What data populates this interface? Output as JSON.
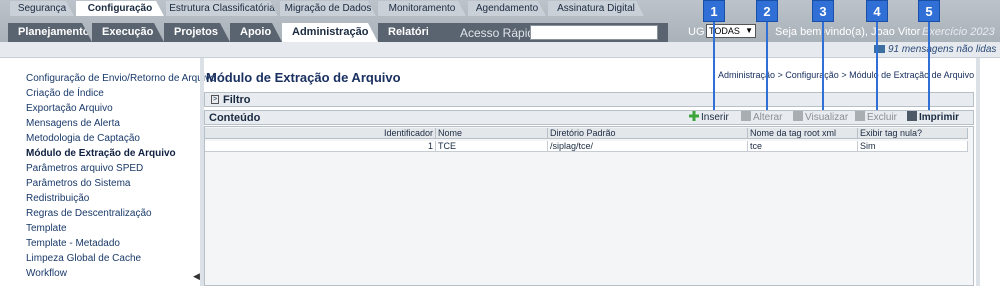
{
  "main_menu": [
    "Planejamento",
    "Execução",
    "Projetos",
    "Apoio",
    "Administração",
    "Relatórios"
  ],
  "active_main": "Administração",
  "quick_access": {
    "label": "Acesso Rápido",
    "value": ""
  },
  "ug": {
    "label": "UG",
    "value": "TODAS"
  },
  "welcome": "Seja bem-vindo(a), Joao Vitor",
  "exercise": "Exercício 2023",
  "sub_tabs": [
    "Segurança",
    "Configuração",
    "Estrutura Classificatória",
    "Migração de Dados",
    "Monitoramento",
    "Agendamento",
    "Assinatura Digital"
  ],
  "active_sub": "Configuração",
  "messages": "91 mensagens não lidas",
  "sidebar": {
    "items": [
      "Configuração de Envio/Retorno de Arquivo",
      "Criação de Índice",
      "Exportação Arquivo",
      "Mensagens de Alerta",
      "Metodologia de Captação",
      "Módulo de Extração de Arquivo",
      "Parâmetros arquivo SPED",
      "Parâmetros do Sistema",
      "Redistribuição",
      "Regras de Descentralização",
      "Template",
      "Template - Metadado",
      "Limpeza Global de Cache",
      "Workflow"
    ],
    "active": "Módulo de Extração de Arquivo"
  },
  "page_title": "Módulo de Extração de Arquivo",
  "breadcrumb": "Administração > Configuração > Módulo de Extração de Arquivo",
  "filter_label": "Filtro",
  "content_label": "Conteúdo",
  "toolbar": {
    "insert": "Inserir",
    "edit": "Alterar",
    "view": "Visualizar",
    "delete": "Excluir",
    "print": "Imprimir"
  },
  "table": {
    "columns": [
      "Identificador",
      "Nome",
      "Diretório Padrão",
      "Nome da tag root xml",
      "Exibir tag nula?"
    ],
    "rows": [
      [
        "1",
        "TCE",
        "/siplag/tce/",
        "tce",
        "Sim"
      ]
    ]
  },
  "callouts": [
    "1",
    "2",
    "3",
    "4",
    "5"
  ],
  "colors": {
    "callout": "#2f6fd6",
    "menu_bg": "#5a6470",
    "title": "#1a3060"
  }
}
